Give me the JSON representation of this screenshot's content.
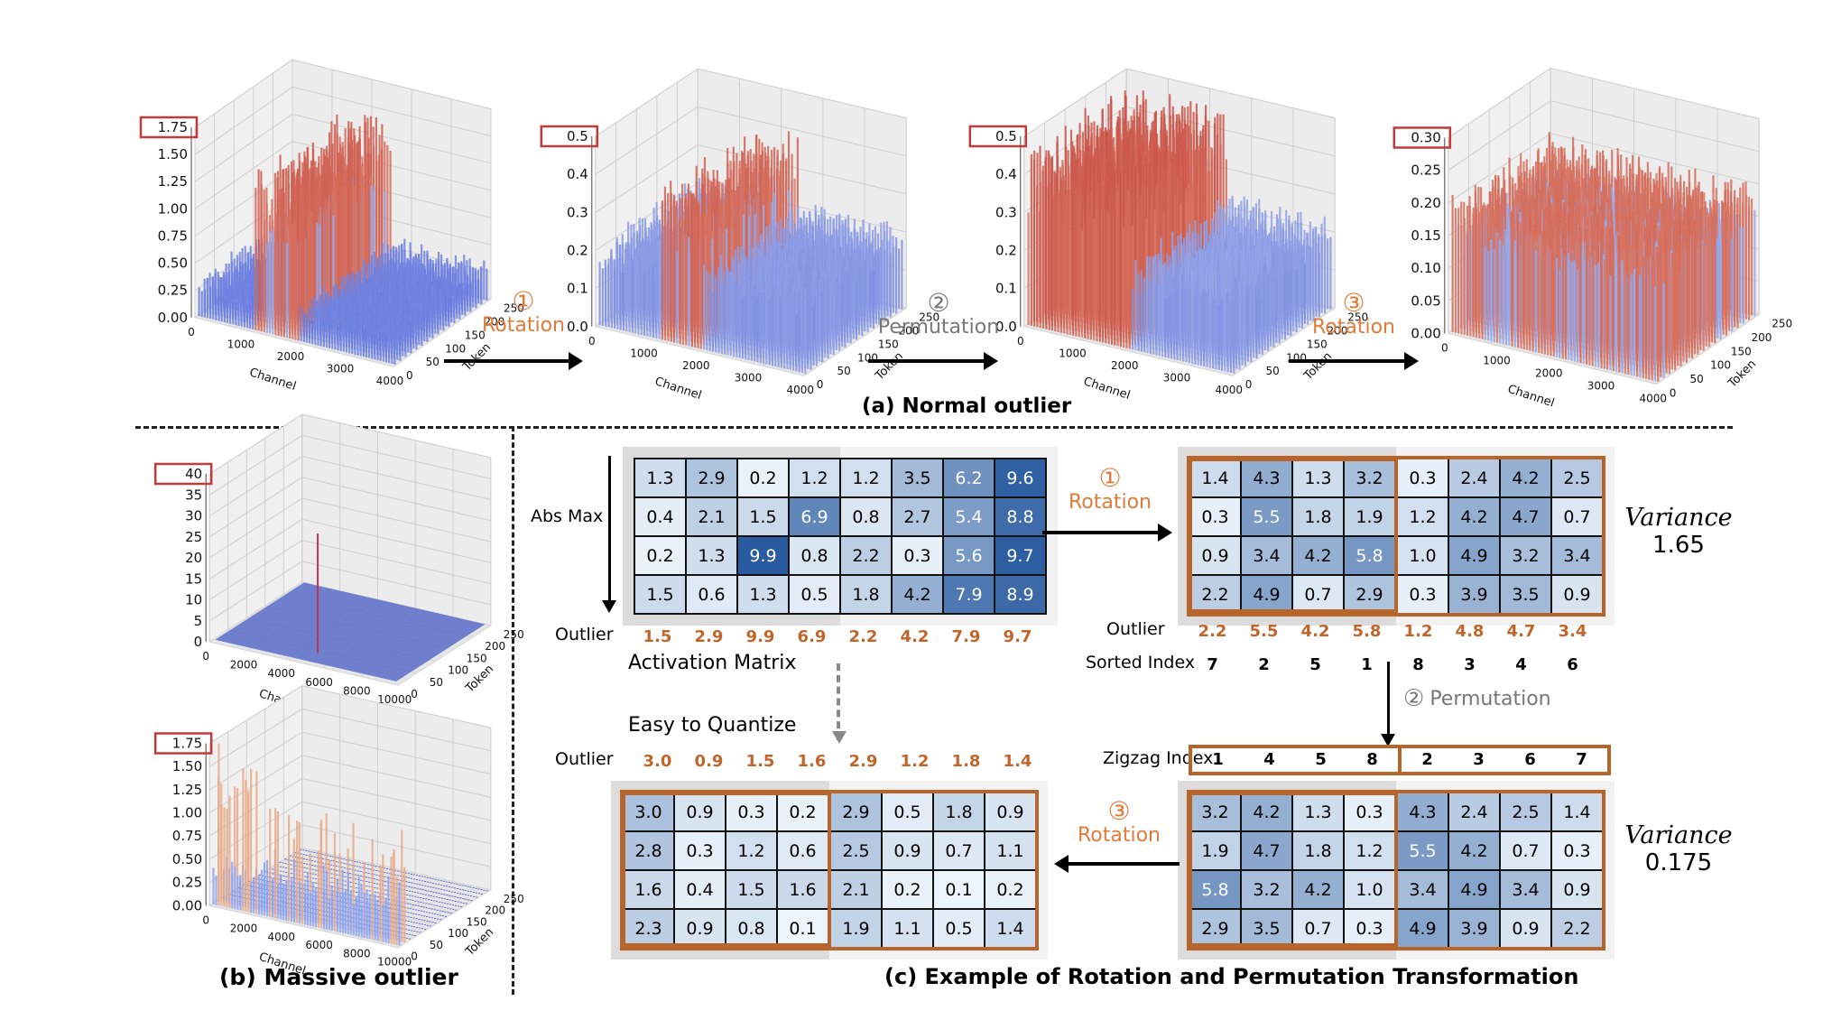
{
  "chart_data": [
    {
      "type": "surface3d",
      "id": "normal-original",
      "xlabel": "Channel",
      "ylabel": "Token",
      "x_ticks": [
        "0",
        "1000",
        "2000",
        "3000",
        "4000"
      ],
      "y_ticks": [
        "0",
        "50",
        "100",
        "150",
        "200",
        "250"
      ],
      "z_ticks": [
        "0.00",
        "0.25",
        "0.50",
        "0.75",
        "1.00",
        "1.25",
        "1.50",
        "1.75"
      ],
      "z_max_highlight": "1.75",
      "zlim": [
        0,
        1.75
      ],
      "description": "single band of large outliers in a few channels, rest near 0.2"
    },
    {
      "type": "surface3d",
      "id": "normal-after-rotation",
      "xlabel": "Channel",
      "ylabel": "Token",
      "x_ticks": [
        "0",
        "1000",
        "2000",
        "3000",
        "4000"
      ],
      "y_ticks": [
        "0",
        "50",
        "100",
        "150",
        "200",
        "250"
      ],
      "z_ticks": [
        "0.0",
        "0.1",
        "0.2",
        "0.3",
        "0.4",
        "0.5"
      ],
      "z_max_highlight": "0.5",
      "zlim": [
        0,
        0.5
      ]
    },
    {
      "type": "surface3d",
      "id": "normal-after-permutation",
      "xlabel": "Channel",
      "ylabel": "Token",
      "x_ticks": [
        "0",
        "1000",
        "2000",
        "3000",
        "4000"
      ],
      "y_ticks": [
        "0",
        "50",
        "100",
        "150",
        "200",
        "250"
      ],
      "z_ticks": [
        "0.0",
        "0.1",
        "0.2",
        "0.3",
        "0.4",
        "0.5"
      ],
      "z_max_highlight": "0.5",
      "zlim": [
        0,
        0.5
      ]
    },
    {
      "type": "surface3d",
      "id": "normal-after-second-rotation",
      "xlabel": "Channel",
      "ylabel": "Token",
      "x_ticks": [
        "0",
        "1000",
        "2000",
        "3000",
        "4000"
      ],
      "y_ticks": [
        "0",
        "50",
        "100",
        "150",
        "200",
        "250"
      ],
      "z_ticks": [
        "0.00",
        "0.05",
        "0.10",
        "0.15",
        "0.20",
        "0.25",
        "0.30"
      ],
      "z_max_highlight": "0.30",
      "zlim": [
        0,
        0.3
      ]
    },
    {
      "type": "surface3d",
      "id": "massive-original",
      "xlabel": "Channel",
      "ylabel": "Token",
      "x_ticks": [
        "0",
        "2000",
        "4000",
        "6000",
        "8000",
        "10000"
      ],
      "y_ticks": [
        "0",
        "50",
        "100",
        "150",
        "200",
        "250"
      ],
      "z_ticks": [
        "0",
        "5",
        "10",
        "15",
        "20",
        "25",
        "30",
        "35",
        "40"
      ],
      "z_max_highlight": "40",
      "zlim": [
        0,
        40
      ]
    },
    {
      "type": "surface3d",
      "id": "massive-after-transform",
      "xlabel": "Channel",
      "ylabel": "Token",
      "x_ticks": [
        "0",
        "2000",
        "4000",
        "6000",
        "8000",
        "10000"
      ],
      "y_ticks": [
        "0",
        "50",
        "100",
        "150",
        "200",
        "250"
      ],
      "z_ticks": [
        "0.00",
        "0.25",
        "0.50",
        "0.75",
        "1.00",
        "1.25",
        "1.50",
        "1.75"
      ],
      "z_max_highlight": "1.75",
      "zlim": [
        0,
        1.75
      ]
    }
  ],
  "steps": {
    "s1": {
      "num": "①",
      "label": "Rotation"
    },
    "s2": {
      "num": "②",
      "label": "Permutation"
    },
    "s3": {
      "num": "③",
      "label": "Rotation"
    }
  },
  "captions": {
    "a": "(a) Normal outlier",
    "b": "(b) Massive outlier",
    "c": "(c) Example of Rotation and Permutation Transformation"
  },
  "example": {
    "abs_max_label": "Abs Max",
    "outlier_label": "Outlier",
    "activation_label": "Activation Matrix",
    "easy_label": "Easy to Quantize",
    "sorted_index_label": "Sorted Index",
    "zigzag_index_label": "Zigzag Index",
    "variance_label": "Variance",
    "colors": {
      "accent": "#c0652b",
      "frame": "#b8652c",
      "step_orange": "#e07b39",
      "step_grey": "#777777"
    },
    "activation": {
      "rows": [
        [
          "1.3",
          "2.9",
          "0.2",
          "1.2",
          "1.2",
          "3.5",
          "6.2",
          "9.6"
        ],
        [
          "0.4",
          "2.1",
          "1.5",
          "6.9",
          "0.8",
          "2.7",
          "5.4",
          "8.8"
        ],
        [
          "0.2",
          "1.3",
          "9.9",
          "0.8",
          "2.2",
          "0.3",
          "5.6",
          "9.7"
        ],
        [
          "1.5",
          "0.6",
          "1.3",
          "0.5",
          "1.8",
          "4.2",
          "7.9",
          "8.9"
        ]
      ],
      "outliers": [
        "1.5",
        "2.9",
        "9.9",
        "6.9",
        "2.2",
        "4.2",
        "7.9",
        "9.7"
      ]
    },
    "rotated": {
      "rows": [
        [
          "1.4",
          "4.3",
          "1.3",
          "3.2",
          "0.3",
          "2.4",
          "4.2",
          "2.5"
        ],
        [
          "0.3",
          "5.5",
          "1.8",
          "1.9",
          "1.2",
          "4.2",
          "4.7",
          "0.7"
        ],
        [
          "0.9",
          "3.4",
          "4.2",
          "5.8",
          "1.0",
          "4.9",
          "3.2",
          "3.4"
        ],
        [
          "2.2",
          "4.9",
          "0.7",
          "2.9",
          "0.3",
          "3.9",
          "3.5",
          "0.9"
        ]
      ],
      "outliers": [
        "2.2",
        "5.5",
        "4.2",
        "5.8",
        "1.2",
        "4.8",
        "4.7",
        "3.4"
      ],
      "sorted_index": [
        "7",
        "2",
        "5",
        "1",
        "8",
        "3",
        "4",
        "6"
      ],
      "variance": "1.65"
    },
    "permuted": {
      "zigzag_index": [
        "1",
        "4",
        "5",
        "8",
        "2",
        "3",
        "6",
        "7"
      ],
      "rows": [
        [
          "3.2",
          "4.2",
          "1.3",
          "0.3",
          "4.3",
          "2.4",
          "2.5",
          "1.4"
        ],
        [
          "1.9",
          "4.7",
          "1.8",
          "1.2",
          "5.5",
          "4.2",
          "0.7",
          "0.3"
        ],
        [
          "5.8",
          "3.2",
          "4.2",
          "1.0",
          "3.4",
          "4.9",
          "3.4",
          "0.9"
        ],
        [
          "2.9",
          "3.5",
          "0.7",
          "0.3",
          "4.9",
          "3.9",
          "0.9",
          "2.2"
        ]
      ],
      "variance": "0.175"
    },
    "final": {
      "outliers": [
        "3.0",
        "0.9",
        "1.5",
        "1.6",
        "2.9",
        "1.2",
        "1.8",
        "1.4"
      ],
      "rows": [
        [
          "3.0",
          "0.9",
          "0.3",
          "0.2",
          "2.9",
          "0.5",
          "1.8",
          "0.9"
        ],
        [
          "2.8",
          "0.3",
          "1.2",
          "0.6",
          "2.5",
          "0.9",
          "0.7",
          "1.1"
        ],
        [
          "1.6",
          "0.4",
          "1.5",
          "1.6",
          "2.1",
          "0.2",
          "0.1",
          "0.2"
        ],
        [
          "2.3",
          "0.9",
          "0.8",
          "0.1",
          "1.9",
          "1.1",
          "0.5",
          "1.4"
        ]
      ]
    }
  }
}
